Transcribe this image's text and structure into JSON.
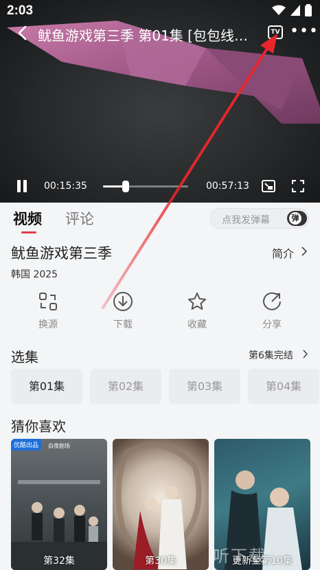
{
  "status_bar": {
    "time": "2:03"
  },
  "player": {
    "title": "鱿鱼游戏第三季 第01集 [包包线…",
    "tv_label": "TV",
    "current_time": "00:15:35",
    "duration": "00:57:13",
    "progress": 0.27
  },
  "tabs": [
    {
      "label": "视频"
    },
    {
      "label": "评论"
    }
  ],
  "danmu": {
    "placeholder": "点我发弹幕",
    "toggle_label": "弹"
  },
  "show": {
    "title": "鱿鱼游戏第三季",
    "intro_label": "简介",
    "region": "韩国",
    "year": "2025"
  },
  "actions": [
    {
      "label": "换源",
      "icon": "switch-source-icon"
    },
    {
      "label": "下载",
      "icon": "download-icon"
    },
    {
      "label": "收藏",
      "icon": "star-icon"
    },
    {
      "label": "分享",
      "icon": "share-icon"
    }
  ],
  "episodes": {
    "title": "选集",
    "status": "第6集完结",
    "items": [
      "第01集",
      "第02集",
      "第03集",
      "第04集"
    ],
    "selected_index": 0
  },
  "recommend": {
    "title": "猜你喜欢",
    "items": [
      {
        "label": "第32集",
        "badge": "优酷出品",
        "brand": "白夜剧场"
      },
      {
        "label": "第30集"
      },
      {
        "label": "更新至第10集"
      }
    ]
  },
  "watermark": "听下载",
  "colors": {
    "accent": "#e43a4c",
    "annotation_arrow": "#e8262b"
  }
}
